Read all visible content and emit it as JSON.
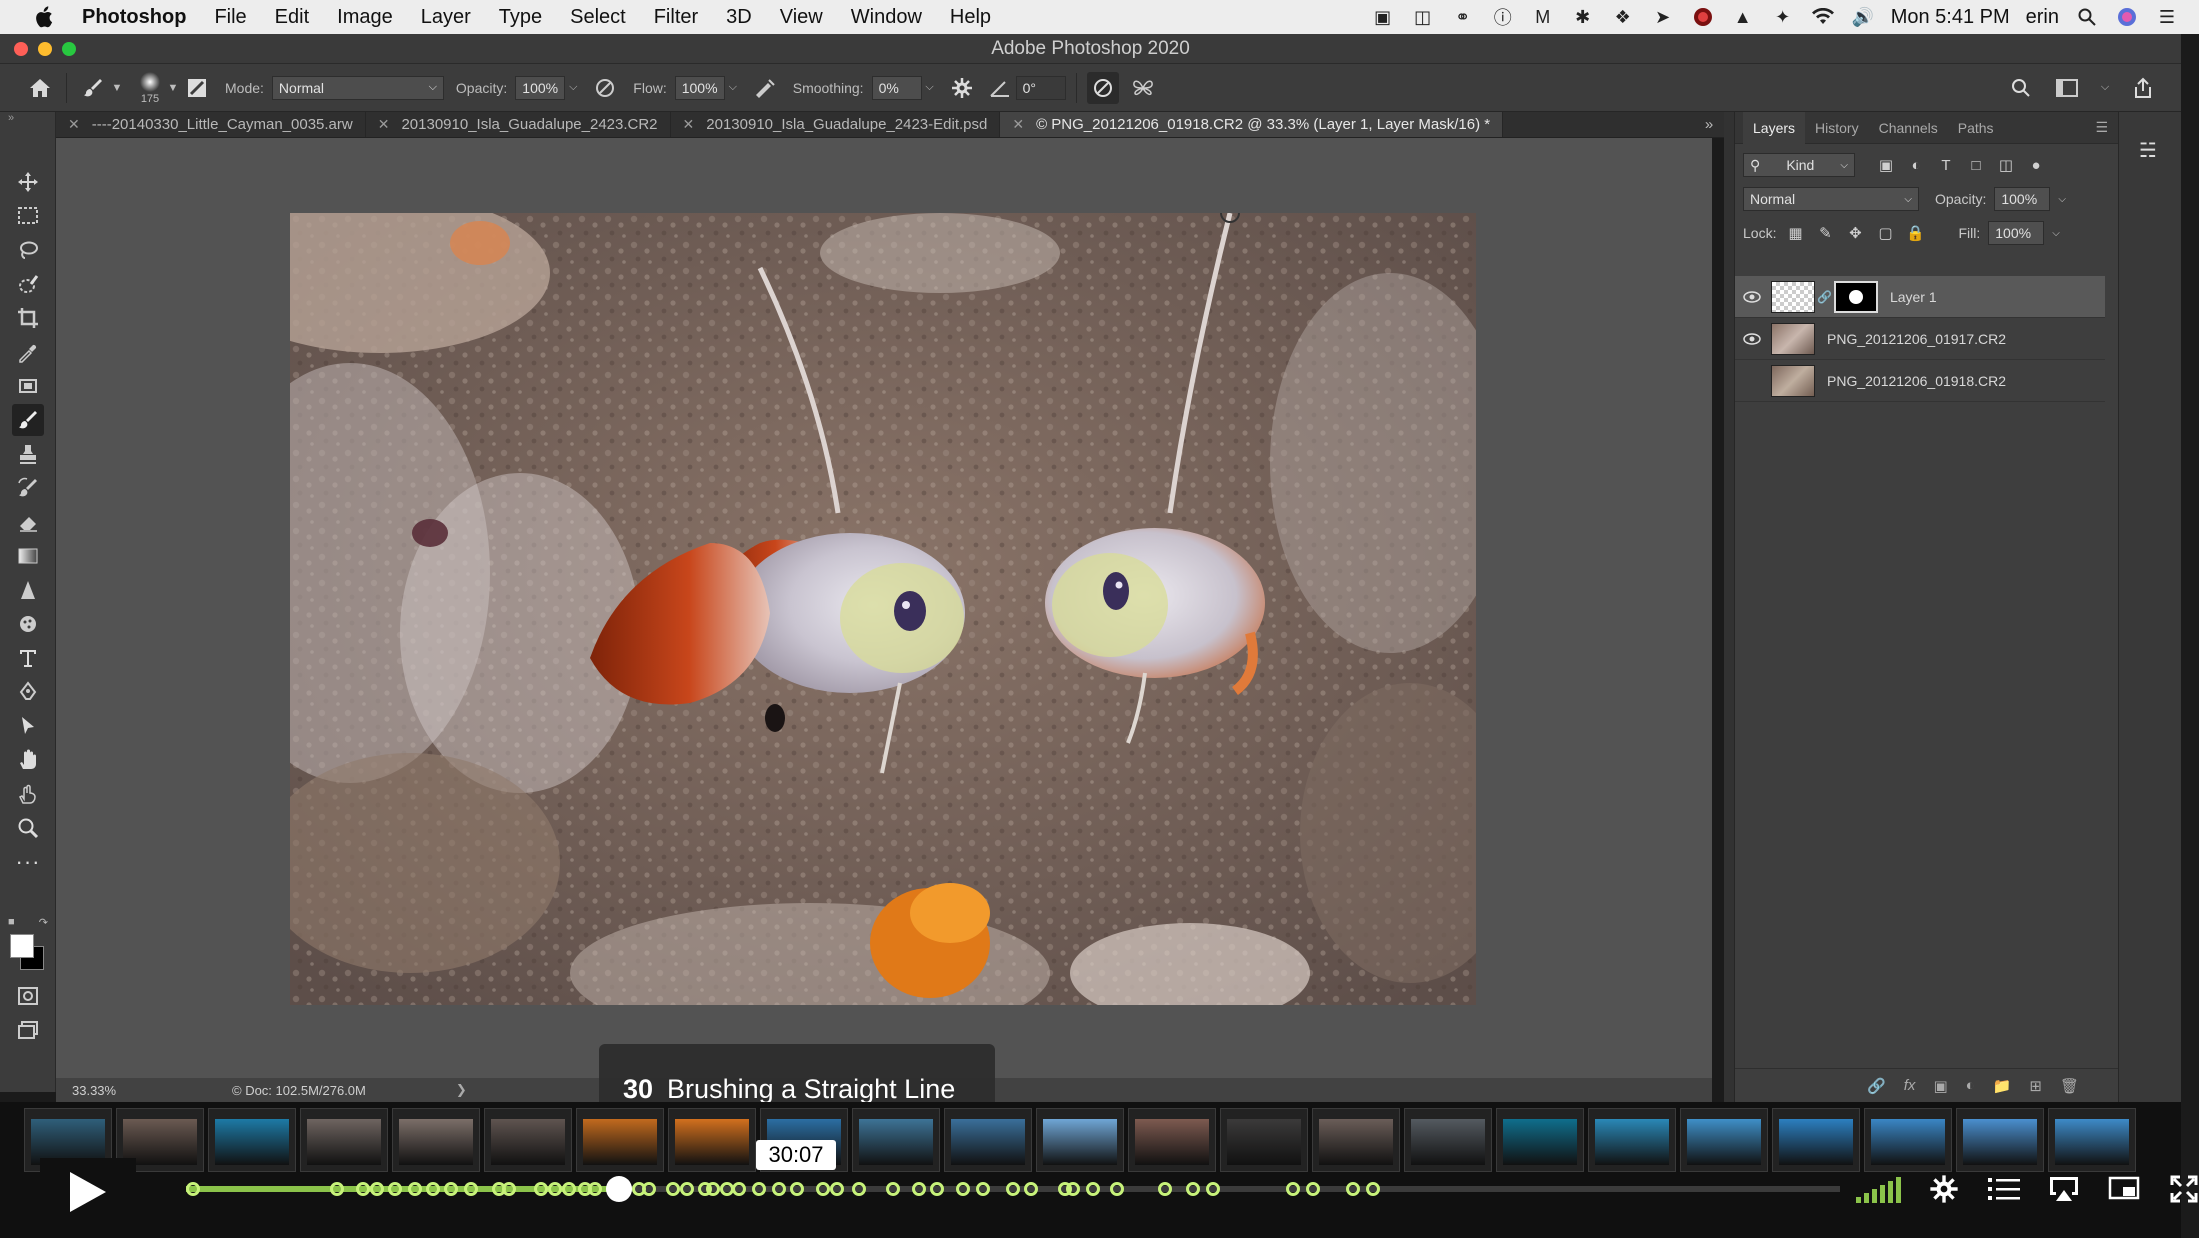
{
  "menubar": {
    "app_name": "Photoshop",
    "items": [
      "File",
      "Edit",
      "Image",
      "Layer",
      "Type",
      "Select",
      "Filter",
      "3D",
      "View",
      "Window",
      "Help"
    ],
    "clock": "Mon 5:41 PM",
    "user": "erin"
  },
  "window": {
    "title": "Adobe Photoshop 2020"
  },
  "options": {
    "brush_size": "175",
    "mode_label": "Mode:",
    "mode_value": "Normal",
    "opacity_label": "Opacity:",
    "opacity_value": "100%",
    "flow_label": "Flow:",
    "flow_value": "100%",
    "smoothing_label": "Smoothing:",
    "smoothing_value": "0%",
    "angle_value": "0°"
  },
  "tabs": [
    {
      "label": "----20140330_Little_Cayman_0035.arw"
    },
    {
      "label": "20130910_Isla_Guadalupe_2423.CR2"
    },
    {
      "label": "20130910_Isla_Guadalupe_2423-Edit.psd"
    },
    {
      "label": "© PNG_20121206_01918.CR2 @ 33.3% (Layer 1, Layer Mask/16) *"
    }
  ],
  "status": {
    "zoom": "33.33%",
    "doc": "© Doc: 102.5M/276.0M"
  },
  "layers_panel": {
    "tabs": [
      "Layers",
      "History",
      "Channels",
      "Paths"
    ],
    "filter_label": "Kind",
    "blend_mode": "Normal",
    "opacity_label": "Opacity:",
    "opacity_value": "100%",
    "lock_label": "Lock:",
    "fill_label": "Fill:",
    "fill_value": "100%",
    "layers": [
      {
        "name": "Layer 1"
      },
      {
        "name": "PNG_20121206_01917.CR2"
      },
      {
        "name": "PNG_20121206_01918.CR2"
      }
    ]
  },
  "player": {
    "chapter_number": "30",
    "chapter_title": "Brushing a Straight Line",
    "timecode": "30:07",
    "progress_fraction": 0.262
  },
  "colors": {
    "accent_green": "#8bc34a",
    "marker_green": "#c7f27a",
    "app_dark": "#3c3c3c",
    "canvas_gray": "#535353"
  }
}
